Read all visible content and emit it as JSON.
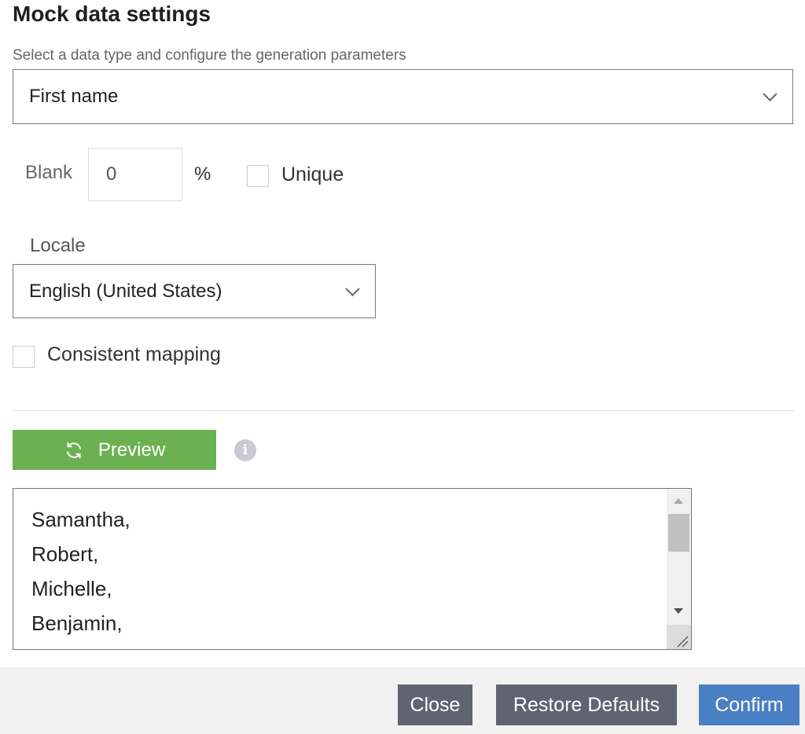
{
  "title": "Mock data settings",
  "subtitle": "Select a data type and configure the generation parameters",
  "data_type": {
    "selected": "First name",
    "icon": "chevron-down-icon"
  },
  "blank": {
    "label": "Blank",
    "value": "0",
    "unit": "%"
  },
  "unique": {
    "label": "Unique",
    "checked": false
  },
  "locale": {
    "label": "Locale",
    "selected": "English (United States)"
  },
  "consistent_mapping": {
    "label": "Consistent mapping",
    "checked": false
  },
  "preview": {
    "button_label": "Preview",
    "icon": "refresh-icon",
    "info_icon": "info-icon",
    "lines": [
      "Samantha,",
      "Robert,",
      "Michelle,",
      "Benjamin,"
    ]
  },
  "footer": {
    "close": "Close",
    "restore": "Restore Defaults",
    "confirm": "Confirm"
  },
  "colors": {
    "preview": "#6cb151",
    "secondary": "#5e6470",
    "primary": "#4a7fc4"
  }
}
